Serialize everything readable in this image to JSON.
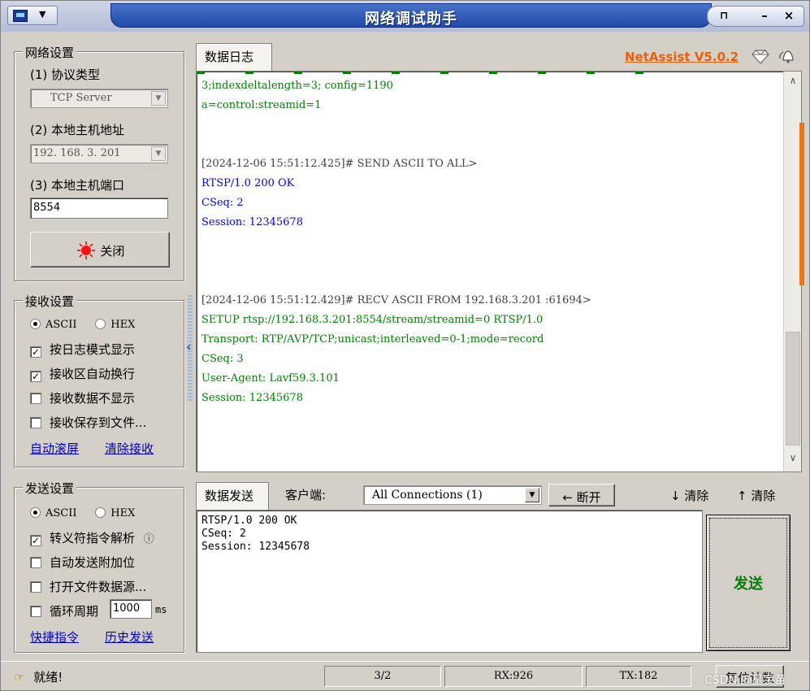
{
  "window": {
    "title": "网络调试助手",
    "controls": {
      "pin": "⊓",
      "minimize": "–",
      "close": "×"
    }
  },
  "network_settings": {
    "group_title": "网络设置",
    "protocol_label": "(1) 协议类型",
    "protocol_value": "TCP Server",
    "host_label": "(2) 本地主机地址",
    "host_value": "192. 168. 3. 201",
    "port_label": "(3) 本地主机端口",
    "port_value": "8554",
    "close_button": "关闭"
  },
  "receive_settings": {
    "group_title": "接收设置",
    "radio_ascii": "ASCII",
    "radio_hex": "HEX",
    "check_log_mode": "按日志模式显示",
    "check_auto_wrap": "接收区自动换行",
    "check_hide_data": "接收数据不显示",
    "check_save_file": "接收保存到文件...",
    "link_auto_scroll": "自动滚屏",
    "link_clear": "清除接收"
  },
  "send_settings": {
    "group_title": "发送设置",
    "radio_ascii": "ASCII",
    "radio_hex": "HEX",
    "check_escape": "转义符指令解析",
    "check_append": "自动发送附加位",
    "check_file_source": "打开文件数据源...",
    "check_loop": "循环周期",
    "loop_value": "1000",
    "loop_unit": "ms",
    "link_shortcuts": "快捷指令",
    "link_history": "历史发送"
  },
  "log": {
    "tab_label": "数据日志",
    "brand": "NetAssist V5.0.2",
    "lines": [
      {
        "text": "3;indexdeltalength=3; config=1190",
        "color": "green"
      },
      {
        "text": "a=control:streamid=1",
        "color": "green"
      },
      {
        "text": "[2024-12-06 15:51:12.425]# SEND ASCII TO ALL>",
        "color": "gray"
      },
      {
        "text": "RTSP/1.0 200 OK",
        "color": "blue"
      },
      {
        "text": "CSeq: 2",
        "color": "blue"
      },
      {
        "text": "Session: 12345678",
        "color": "blue"
      },
      {
        "text": "[2024-12-06 15:51:12.429]# RECV ASCII FROM 192.168.3.201 :61694>",
        "color": "gray"
      },
      {
        "text": "SETUP rtsp://192.168.3.201:8554/stream/streamid=0 RTSP/1.0",
        "color": "green"
      },
      {
        "text": "Transport: RTP/AVP/TCP;unicast;interleaved=0-1;mode=record",
        "color": "green"
      },
      {
        "text": "CSeq: 3",
        "color": "green"
      },
      {
        "text": "User-Agent: Lavf59.3.101",
        "color": "green"
      },
      {
        "text": "Session: 12345678",
        "color": "green"
      }
    ]
  },
  "send": {
    "tab_label": "数据发送",
    "client_label": "客户端:",
    "client_select": "All Connections (1)",
    "disconnect_button": "断开",
    "clear1": "清除",
    "clear2": "清除",
    "text_lines": [
      "RTSP/1.0 200 OK",
      "CSeq: 2",
      "Session: 12345678"
    ],
    "send_button": "发送"
  },
  "statusbar": {
    "status_text": "就绪!",
    "counter": "3/2",
    "rx": "RX:926",
    "tx": "TX:182",
    "reset_button": "复位计数",
    "watermark": "CSDN @星宇苗"
  }
}
